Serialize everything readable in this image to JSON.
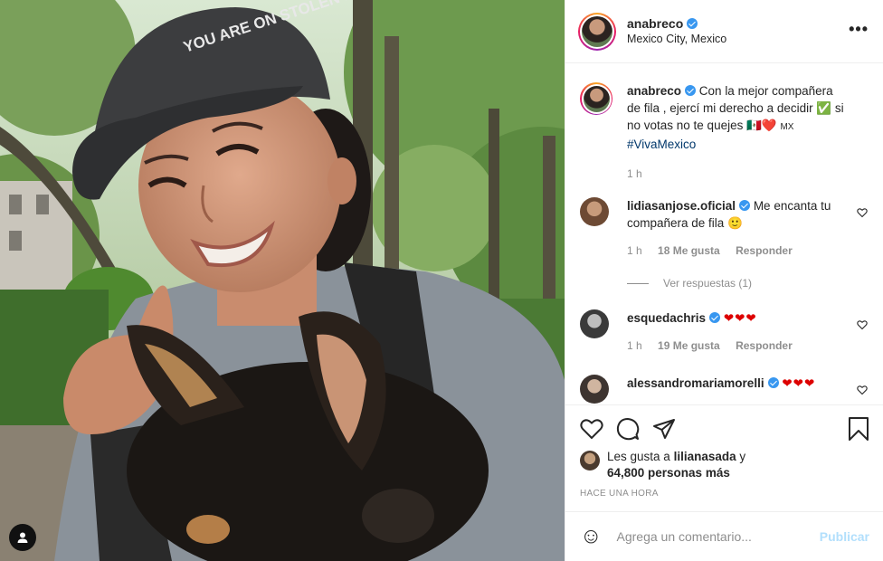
{
  "post": {
    "hat_text": "YOU ARE ON STOLEN LAND"
  },
  "header": {
    "username": "anabreco",
    "location": "Mexico City, Mexico",
    "more": "•••"
  },
  "caption": {
    "username": "anabreco",
    "text_line1": "Con la mejor compañera de fila , ejercí mi derecho a decidir ✅ si no votas no te quejes 🇲🇽❤️ ",
    "text_flag": "MX",
    "hashtag": "#VivaMexico",
    "time": "1 h"
  },
  "comments": [
    {
      "username": "lidiasanjose.oficial",
      "text": "Me encanta tu compañera de fila 🙂",
      "time": "1 h",
      "likes": "18 Me gusta",
      "reply": "Responder",
      "view_replies": "Ver respuestas (1)"
    },
    {
      "username": "esquedachris",
      "text": "❤❤❤",
      "time": "1 h",
      "likes": "19 Me gusta",
      "reply": "Responder"
    },
    {
      "username": "alessandromariamorelli",
      "text": "❤❤❤"
    }
  ],
  "likes": {
    "prefix": "Les gusta a",
    "user": "lilianasada",
    "connector": "y",
    "count": "64,800 personas más"
  },
  "timestamp": "HACE UNA HORA",
  "add_comment": {
    "emoji": "☺",
    "placeholder": "Agrega un comentario...",
    "publish": "Publicar"
  },
  "colors": {
    "verified": "#3897f0",
    "link": "#00376b",
    "muted": "#8e8e8e",
    "publish_disabled": "#b2dffc",
    "heart_red": "#dd0000"
  },
  "icons": [
    "heart-icon",
    "comment-icon",
    "share-icon",
    "bookmark-icon",
    "more-icon",
    "user-tag-icon",
    "emoji-icon"
  ]
}
